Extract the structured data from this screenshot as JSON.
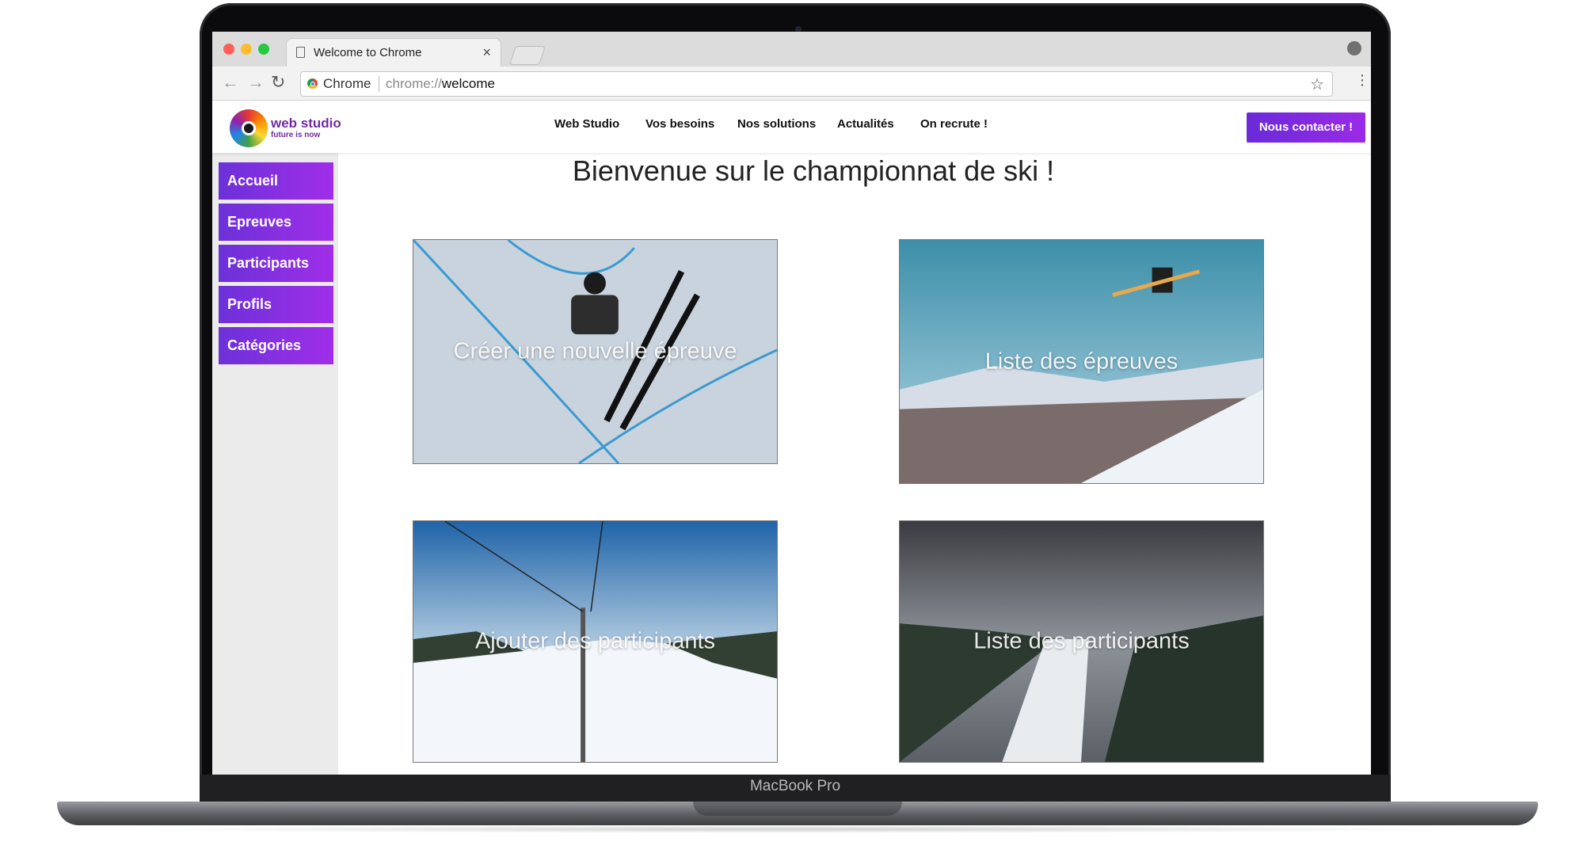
{
  "device": {
    "label": "MacBook Pro"
  },
  "browser": {
    "tab_title": "Welcome to Chrome",
    "omnibox_label": "Chrome",
    "url_scheme": "chrome://",
    "url_path": "welcome"
  },
  "site": {
    "logo_name": "web studio",
    "logo_tagline": "future is now",
    "nav": [
      "Web Studio",
      "Vos besoins",
      "Nos solutions",
      "Actualités",
      "On recrute !"
    ],
    "cta": "Nous contacter !"
  },
  "sidebar": {
    "items": [
      "Accueil",
      "Epreuves",
      "Participants",
      "Profils",
      "Catégories"
    ]
  },
  "main": {
    "title": "Bienvenue sur le championnat de ski !",
    "cards": [
      "Créer une nouvelle épreuve",
      "Liste des épreuves",
      "Ajouter des participants",
      "Liste des participants"
    ]
  },
  "colors": {
    "accent_start": "#6a2ad8",
    "accent_end": "#a02ee8",
    "brand_text": "#6f2aa0"
  }
}
